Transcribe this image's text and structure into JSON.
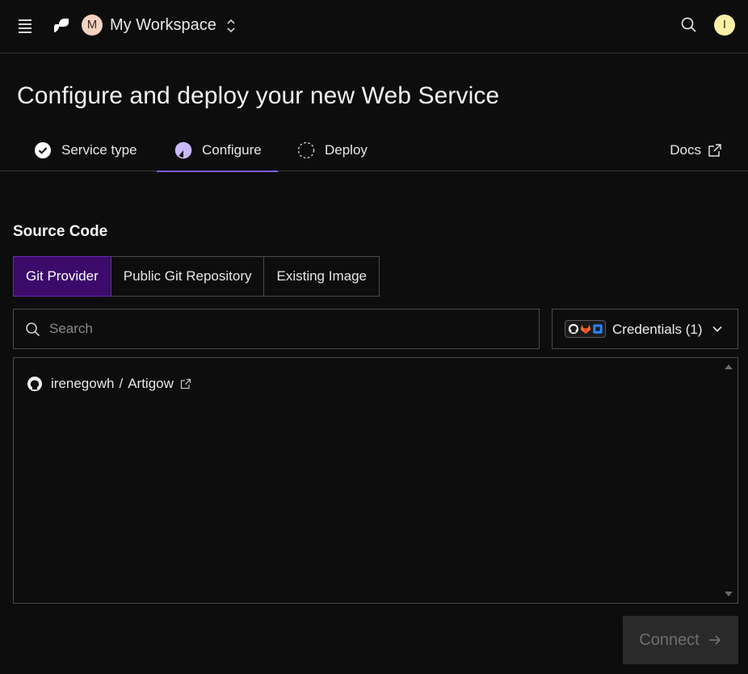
{
  "header": {
    "workspace_initial": "M",
    "workspace_name": "My Workspace",
    "user_initial": "I"
  },
  "page": {
    "title": "Configure and deploy your new Web Service"
  },
  "steps": [
    {
      "label": "Service type",
      "state": "complete"
    },
    {
      "label": "Configure",
      "state": "active"
    },
    {
      "label": "Deploy",
      "state": "pending"
    }
  ],
  "docs_label": "Docs",
  "source_code": {
    "title": "Source Code",
    "tabs": [
      {
        "label": "Git Provider",
        "selected": true
      },
      {
        "label": "Public Git Repository",
        "selected": false
      },
      {
        "label": "Existing Image",
        "selected": false
      }
    ],
    "search_placeholder": "Search",
    "credentials_label": "Credentials (1)",
    "repos": [
      {
        "owner": "irenegowh",
        "separator": "/",
        "name": "Artigow"
      }
    ]
  },
  "connect_label": "Connect",
  "colors": {
    "accent": "#7c5cff",
    "selected_tab_bg": "#3b0a6b"
  }
}
